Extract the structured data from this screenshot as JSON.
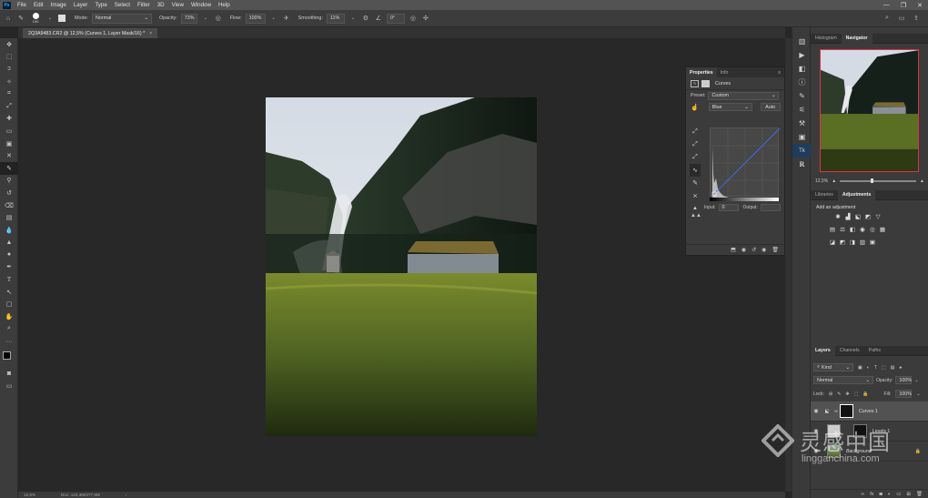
{
  "app": {
    "logo": "Ps"
  },
  "menubar": {
    "items": [
      "File",
      "Edit",
      "Image",
      "Layer",
      "Type",
      "Select",
      "Filter",
      "3D",
      "View",
      "Window",
      "Help"
    ]
  },
  "window_controls": {
    "minimize": "—",
    "restore": "❐",
    "close": "✕"
  },
  "options_bar": {
    "brush_size": "150",
    "mode_label": "Mode:",
    "mode_value": "Normal",
    "opacity_label": "Opacity:",
    "opacity_value": "73%",
    "flow_label": "Flow:",
    "flow_value": "100%",
    "smoothing_label": "Smoothing:",
    "smoothing_value": "11%",
    "angle_value": "0°"
  },
  "document": {
    "tab_title": "2Q3A9483.CR2 @ 12,5% (Curves 1, Layer Mask/16) *",
    "close": "×"
  },
  "status_bar": {
    "zoom": "12,5%",
    "doc": "Doc: 143,4M/277,9M",
    "arrow": "›"
  },
  "properties": {
    "tabs": [
      "Properties",
      "Info"
    ],
    "active_tab": "Properties",
    "title": "Curves",
    "preset_label": "Preset:",
    "preset_value": "Custom",
    "channel_value": "Blue",
    "auto_label": "Auto",
    "input_label": "Input:",
    "input_value": "0",
    "output_label": "Output:"
  },
  "navigator": {
    "tabs": [
      "Histogram",
      "Navigator"
    ],
    "active_tab": "Navigator",
    "zoom": "12,5%"
  },
  "adjustments": {
    "tabs": [
      "Libraries",
      "Adjustments"
    ],
    "active_tab": "Adjustments",
    "add_label": "Add an adjustment"
  },
  "layers_panel": {
    "tabs": [
      "Layers",
      "Channels",
      "Paths"
    ],
    "active_tab": "Layers",
    "filter_value": "Kind",
    "blend_value": "Normal",
    "opacity_label": "Opacity:",
    "opacity_value": "100%",
    "lock_label": "Lock:",
    "fill_label": "Fill:",
    "fill_value": "100%",
    "layers": [
      {
        "name": "Curves 1"
      },
      {
        "name": "Levels 1"
      },
      {
        "name": "Background"
      }
    ]
  },
  "watermark": {
    "brand": "灵感中国",
    "url": "lingganchina.com"
  },
  "colors": {
    "accent": "#31a8ff",
    "panel": "#3b3b3b",
    "canvas": "#282828",
    "nav_frame": "#e0304a"
  }
}
